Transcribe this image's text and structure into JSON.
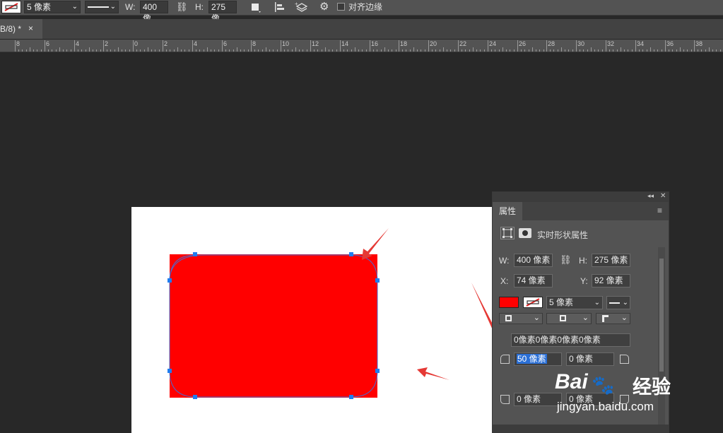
{
  "options_bar": {
    "stroke_width": "5 像素",
    "w_label": "W:",
    "w_value": "400 像",
    "h_label": "H:",
    "h_value": "275 像",
    "align_edges_label": "对齐边缘"
  },
  "document_tab": {
    "title": "B/8) *",
    "close": "×"
  },
  "ruler": {
    "labels": [
      "8",
      "6",
      "4",
      "2",
      "0",
      "2",
      "4",
      "6",
      "8",
      "10",
      "12",
      "14",
      "16",
      "18",
      "20",
      "22",
      "24",
      "26",
      "28",
      "30",
      "32",
      "34",
      "36",
      "38"
    ]
  },
  "properties_panel": {
    "tab_label": "属性",
    "header_label": "实时形状属性",
    "w_label": "W:",
    "w_value": "400 像素",
    "h_label": "H:",
    "h_value": "275 像素",
    "x_label": "X:",
    "x_value": "74 像素",
    "y_label": "Y:",
    "y_value": "92 像素",
    "stroke_width": "5 像素",
    "corner_all": "0像素0像素0像素0像素",
    "corner_tl": "50 像素",
    "corner_tr": "0 像素",
    "corner_bl": "0 像素",
    "corner_br": "0 像素"
  },
  "watermark": {
    "brand": "Bai",
    "brand_suffix": "经验",
    "url": "jingyan.baidu.com"
  },
  "colors": {
    "shape_fill": "#ff0000",
    "handle": "#1f7df0",
    "annotation_arrow": "#e53935"
  }
}
